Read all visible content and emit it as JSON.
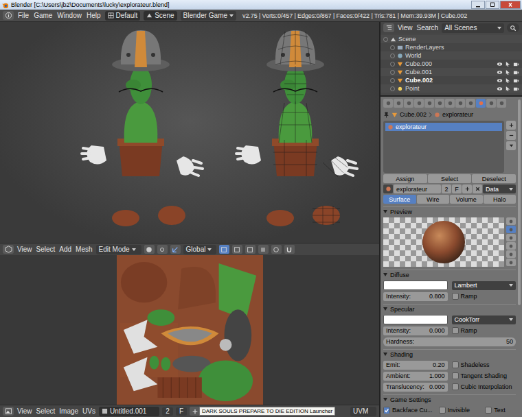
{
  "window": {
    "title": "Blender [C:\\Users\\jb2\\Documents\\lucky\\explorateur.blend]"
  },
  "info_header": {
    "menus": [
      "File",
      "Game",
      "Window",
      "Help"
    ],
    "layout": "Default",
    "scene": "Scene",
    "engine": "Blender Game",
    "stats": "v2.75 | Verts:0/457 | Edges:0/867 | Faces:0/422 | Tris:781 | Mem:39.93M | Cube.002"
  },
  "viewport_header": {
    "menus": [
      "View",
      "Select",
      "Add",
      "Mesh"
    ],
    "mode": "Edit Mode",
    "orientation": "Global",
    "select_modes": [
      {
        "selected": true
      },
      {
        "selected": false
      },
      {
        "selected": false
      }
    ]
  },
  "image_header": {
    "menus": [
      "View",
      "Select",
      "Image",
      "UVs"
    ],
    "image": "Untitled.001",
    "users": "2",
    "fake": "F",
    "uv_map": "UVM"
  },
  "tooltip": {
    "text": "DARK SOULS PREPARE TO DIE EDITION Launcher"
  },
  "outliner": {
    "menus": [
      "View",
      "Search"
    ],
    "filter": "All Scenes",
    "items": [
      {
        "label": "Scene",
        "kind": "scene",
        "selected": false
      },
      {
        "label": "RenderLayers",
        "kind": "renderlayers",
        "selected": false
      },
      {
        "label": "World",
        "kind": "world",
        "selected": false
      },
      {
        "label": "Cube.000",
        "kind": "mesh",
        "selected": false
      },
      {
        "label": "Cube.001",
        "kind": "mesh",
        "selected": false
      },
      {
        "label": "Cube.002",
        "kind": "mesh",
        "selected": true
      },
      {
        "label": "Point",
        "kind": "lamp",
        "selected": false
      }
    ]
  },
  "properties": {
    "context_tabs": [
      {
        "selected": false
      },
      {
        "selected": false
      },
      {
        "selected": false
      },
      {
        "selected": false
      },
      {
        "selected": false
      },
      {
        "selected": false
      },
      {
        "selected": false
      },
      {
        "selected": false
      },
      {
        "selected": false
      },
      {
        "selected": true
      },
      {
        "selected": false
      },
      {
        "selected": false
      }
    ],
    "breadcrumb": [
      "Cube.002",
      "explorateur"
    ],
    "slots": [
      {
        "label": "explorateur",
        "selected": true
      }
    ],
    "slot_buttons": [
      "Assign",
      "Select",
      "Deselect"
    ],
    "material": {
      "name": "explorateur",
      "users": "2",
      "fake": "F",
      "link": "Data"
    },
    "tabs": [
      {
        "label": "Surface",
        "selected": true
      },
      {
        "label": "Wire",
        "selected": false
      },
      {
        "label": "Volume",
        "selected": false
      },
      {
        "label": "Halo",
        "selected": false
      }
    ],
    "preview": {
      "title": "Preview"
    },
    "diffuse": {
      "title": "Diffuse",
      "color": "#ffffff",
      "shader": "Lambert",
      "intensity_label": "Intensity:",
      "intensity": "0.800",
      "ramp": {
        "label": "Ramp",
        "checked": false
      }
    },
    "specular": {
      "title": "Specular",
      "color": "#ffffff",
      "shader": "CookTorr",
      "intensity_label": "Intensity:",
      "intensity": "0.000",
      "ramp": {
        "label": "Ramp",
        "checked": false
      },
      "hardness_label": "Hardness:",
      "hardness": "50"
    },
    "shading": {
      "title": "Shading",
      "fields": [
        {
          "label": "Emit:",
          "value": "0.20"
        },
        {
          "label": "Ambient:",
          "value": "1.000"
        },
        {
          "label": "Translucency:",
          "value": "0.000"
        }
      ],
      "checks": [
        {
          "label": "Shadeless",
          "checked": false
        },
        {
          "label": "Tangent Shading",
          "checked": false
        },
        {
          "label": "Cubic Interpolation",
          "checked": false
        }
      ]
    },
    "game_settings": {
      "title": "Game Settings",
      "checks": [
        {
          "label": "Backface Cu...",
          "checked": true
        },
        {
          "label": "Invisible",
          "checked": false
        },
        {
          "label": "Text",
          "checked": false
        }
      ]
    }
  }
}
